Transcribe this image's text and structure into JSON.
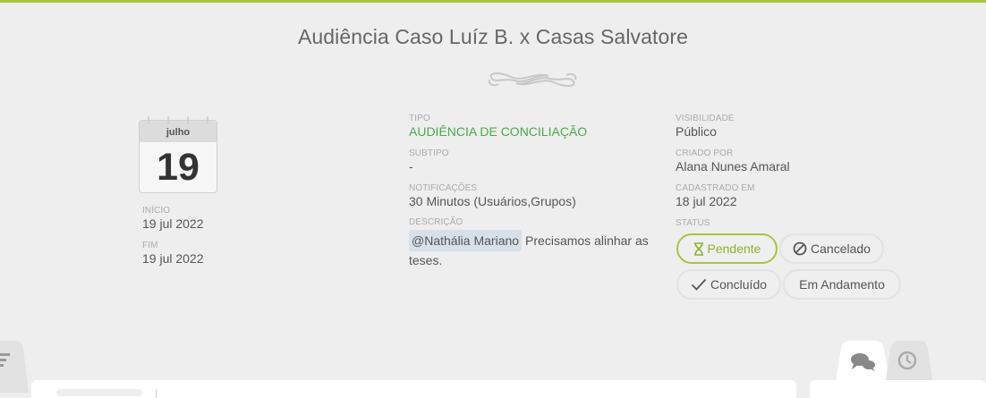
{
  "event": {
    "title": "Audiência Caso Luíz B. x Casas Salvatore"
  },
  "calendar": {
    "month": "julho",
    "day": "19"
  },
  "dates": {
    "start_label": "INÍCIO",
    "start_value": "19 jul 2022",
    "end_label": "FIM",
    "end_value": "19 jul 2022"
  },
  "details": {
    "type_label": "TIPO",
    "type_value": "AUDIÊNCIA DE CONCILIAÇÃO",
    "subtype_label": "SUBTIPO",
    "subtype_value": "-",
    "notifications_label": "NOTIFICAÇÕES",
    "notifications_value": "30 Minutos (Usuários,Grupos)",
    "description_label": "DESCRIÇÃO",
    "description_mention": "@Nathália Mariano",
    "description_text": "Precisamos alinhar as teses."
  },
  "meta": {
    "visibility_label": "VISIBILIDADE",
    "visibility_value": "Público",
    "created_by_label": "CRIADO POR",
    "created_by_value": "Alana Nunes Amaral",
    "registered_label": "CADASTRADO EM",
    "registered_value": "18 jul 2022",
    "status_label": "STATUS"
  },
  "status_options": [
    {
      "label": "Pendente",
      "icon": "hourglass-icon",
      "active": true
    },
    {
      "label": "Cancelado",
      "icon": "cancel-circle-icon",
      "active": false
    },
    {
      "label": "Concluído",
      "icon": "check-icon",
      "active": false
    },
    {
      "label": "Em Andamento",
      "icon": "",
      "active": false
    }
  ],
  "tabs": [
    {
      "icon": "comments-icon",
      "active": true
    },
    {
      "icon": "clock-icon",
      "active": false
    }
  ],
  "colors": {
    "accent": "#a6c63a",
    "type_green": "#4aaa4a",
    "background": "#eeeeee"
  }
}
